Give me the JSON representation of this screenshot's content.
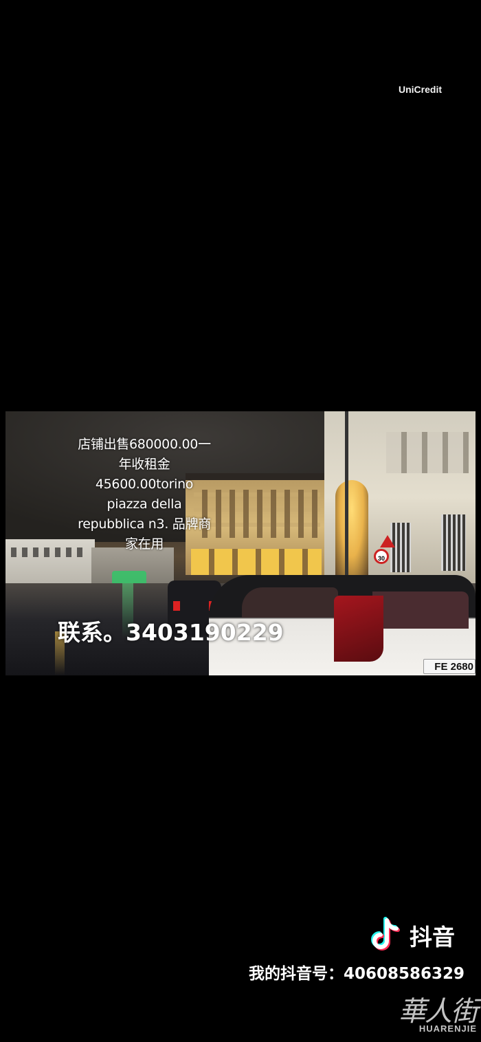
{
  "video": {
    "caption_lines": [
      "店铺出售680000.00一",
      "年收租金",
      "45600.00torino",
      "piazza della",
      "repubblica n3. 品牌商",
      "家在用"
    ],
    "contact": "联系。3403190229",
    "scene": {
      "bank_sign": "UniCredit",
      "speed_sign": "30",
      "plate": "FE 2680"
    }
  },
  "tiktok": {
    "name": "抖音",
    "id_line": "我的抖音号：40608586329",
    "colors": {
      "cyan": "#25F4EE",
      "red": "#FE2C55"
    }
  },
  "watermark": {
    "cjk": "華人街",
    "latin": "HUARENJIE"
  }
}
